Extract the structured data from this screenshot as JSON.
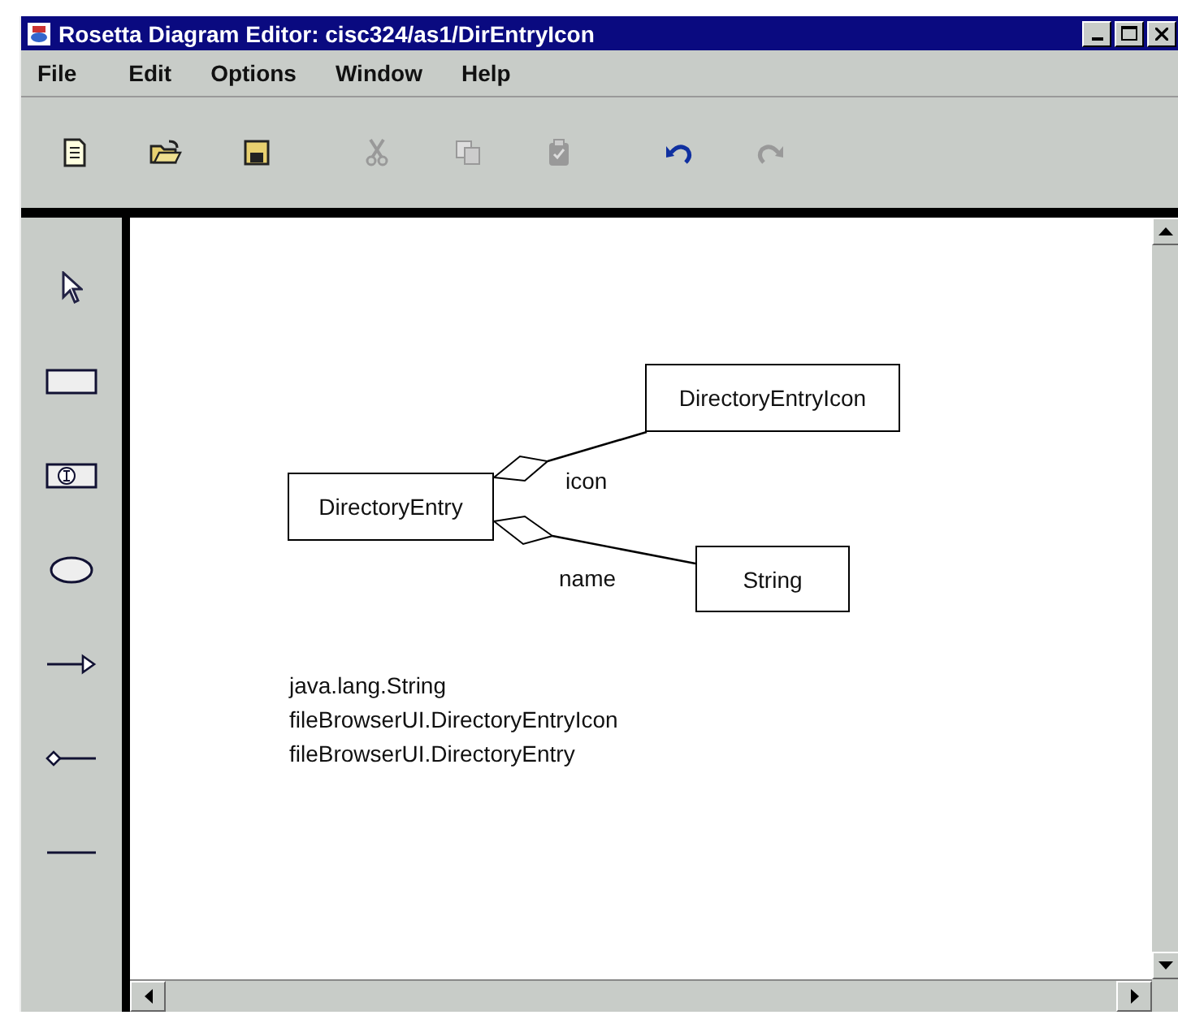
{
  "window": {
    "title": "Rosetta Diagram Editor: cisc324/as1/DirEntryIcon"
  },
  "menu": [
    "File",
    "Edit",
    "Options",
    "Window",
    "Help"
  ],
  "toolbar": [
    {
      "kind": "new",
      "disabled": false
    },
    {
      "kind": "open",
      "disabled": false
    },
    {
      "kind": "save",
      "disabled": false
    },
    {
      "kind": "cut",
      "disabled": true
    },
    {
      "kind": "copy",
      "disabled": true
    },
    {
      "kind": "paste",
      "disabled": true
    },
    {
      "kind": "undo",
      "disabled": false
    },
    {
      "kind": "redo",
      "disabled": true
    }
  ],
  "palette": [
    {
      "kind": "select"
    },
    {
      "kind": "class"
    },
    {
      "kind": "object"
    },
    {
      "kind": "ellipse"
    },
    {
      "kind": "arrow"
    },
    {
      "kind": "aggregation"
    },
    {
      "kind": "line"
    }
  ],
  "diagram": {
    "nodes": [
      {
        "label": "DirectoryEntryIcon"
      },
      {
        "label": "DirectoryEntry"
      },
      {
        "label": "String"
      }
    ],
    "edges": [
      {
        "kind": "aggregation",
        "label": "icon"
      },
      {
        "kind": "aggregation",
        "label": "name"
      }
    ],
    "notes": [
      "java.lang.String",
      "fileBrowserUI.DirectoryEntryIcon",
      "fileBrowserUI.DirectoryEntry"
    ]
  }
}
